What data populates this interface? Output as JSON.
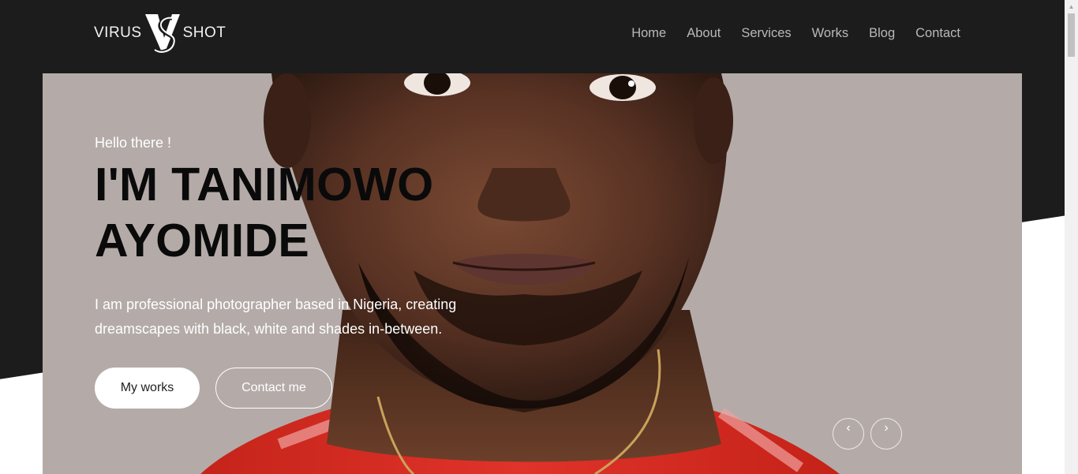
{
  "brand": {
    "left_word": "VIRUS",
    "right_word": "SHOT",
    "mark_letters": "VS"
  },
  "nav": [
    {
      "label": "Home"
    },
    {
      "label": "About"
    },
    {
      "label": "Services"
    },
    {
      "label": "Works"
    },
    {
      "label": "Blog"
    },
    {
      "label": "Contact"
    }
  ],
  "hero": {
    "greeting": "Hello there !",
    "headline_line1": "I'M TANIMOWO",
    "headline_line2": "AYOMIDE",
    "description": "I am professional photographer based in Nigeria, creating dreamscapes with black, white and shades in-between.",
    "primary_button": "My works",
    "secondary_button": "Contact me",
    "prev_arrow": "‹",
    "next_arrow": "›"
  },
  "colors": {
    "header_bg": "#1c1c1c",
    "hero_bg": "#b4aba8",
    "nav_text": "#b9b9b9",
    "headline": "#0a0a0a",
    "shirt_red": "#d42a1e"
  },
  "icons": [
    "logo-mark",
    "chevron-left-icon",
    "chevron-right-icon",
    "scroll-up-arrow-icon"
  ]
}
